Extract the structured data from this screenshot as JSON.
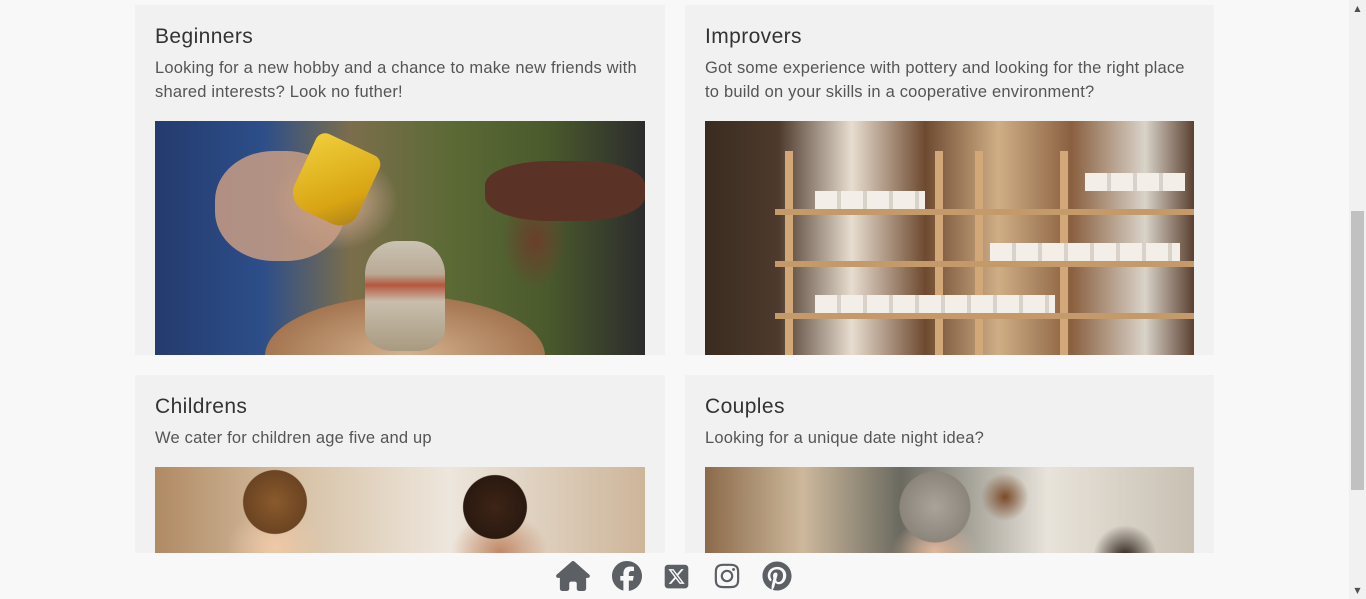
{
  "cards": [
    {
      "title": "Beginners",
      "text": "Looking for a new hobby and a chance to make new friends with shared interests? Look no futher!",
      "image_alt": "hands-shaping-pottery-photo"
    },
    {
      "title": "Improvers",
      "text": "Got some experience with pottery and looking for the right place to build on your skills in a cooperative environment?",
      "image_alt": "pottery-studio-shelves-photo"
    },
    {
      "title": "Childrens",
      "text": "We cater for children age five and up",
      "image_alt": "children-doing-pottery-photo"
    },
    {
      "title": "Couples",
      "text": "Looking for a unique date night idea?",
      "image_alt": "couple-doing-pottery-photo"
    }
  ],
  "footer": {
    "icons": [
      "home-icon",
      "facebook-icon",
      "x-twitter-icon",
      "instagram-icon",
      "pinterest-icon"
    ],
    "icon_color": "#5c5f63"
  },
  "colors": {
    "page_background": "#f8f8f9",
    "card_background": "#f1f1f1"
  },
  "scrollbar": {
    "up_arrow": "▲",
    "down_arrow": "▼"
  }
}
